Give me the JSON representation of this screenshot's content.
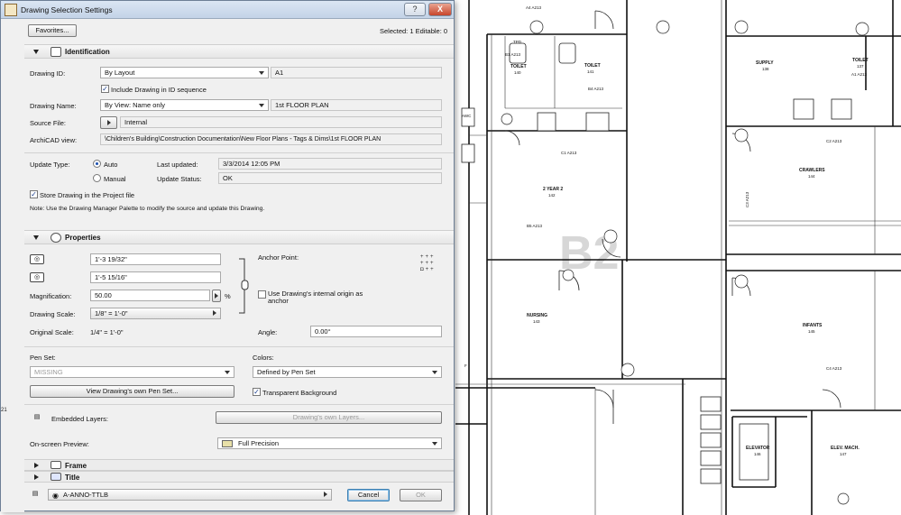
{
  "window": {
    "title": "Drawing Selection Settings",
    "help_label": "?",
    "close_label": "X"
  },
  "header": {
    "favorites_label": "Favorites...",
    "selection_info": "Selected: 1 Editable: 0"
  },
  "identification": {
    "section_title": "Identification",
    "drawing_id_label": "Drawing ID:",
    "drawing_id_mode": "By Layout",
    "drawing_id_value": "A1",
    "include_in_sequence_label": "Include Drawing in ID sequence",
    "include_in_sequence_checked": true,
    "drawing_name_label": "Drawing Name:",
    "drawing_name_mode": "By View: Name only",
    "drawing_name_value": "1st FLOOR PLAN",
    "source_file_label": "Source File:",
    "source_file_value": "Internal",
    "archicad_view_label": "ArchiCAD view:",
    "archicad_view_value": "\\Children's Building\\Construction Documentation\\New Floor Plans - Tags & Dims\\1st FLOOR PLAN",
    "update_type_label": "Update Type:",
    "update_auto_label": "Auto",
    "update_manual_label": "Manual",
    "last_updated_label": "Last updated:",
    "last_updated_value": "3/3/2014 12:05 PM",
    "update_status_label": "Update Status:",
    "update_status_value": "OK",
    "store_drawing_label": "Store Drawing in the Project file",
    "store_drawing_checked": true,
    "note": "Note:   Use the Drawing Manager Palette to modify the source and update this Drawing."
  },
  "properties": {
    "section_title": "Properties",
    "width_value": "1'-3 19/32\"",
    "height_value": "1'-5 15/16\"",
    "magnification_label": "Magnification:",
    "magnification_value": "50.00",
    "magnification_unit": "%",
    "drawing_scale_label": "Drawing Scale:",
    "drawing_scale_value": "1/8\"   =   1'-0\"",
    "original_scale_label": "Original Scale:",
    "original_scale_value": "1/4\"   =   1'-0\"",
    "anchor_point_label": "Anchor Point:",
    "internal_origin_label": "Use Drawing's internal origin as anchor",
    "internal_origin_checked": false,
    "angle_label": "Angle:",
    "angle_value": "0.00°",
    "pen_set_label": "Pen Set:",
    "pen_set_value": "MISSING",
    "view_pen_set_label": "View Drawing's own Pen Set...",
    "colors_label": "Colors:",
    "colors_value": "Defined by Pen Set",
    "transparent_bg_label": "Transparent Background",
    "transparent_bg_checked": true,
    "embedded_layers_label": "Embedded Layers:",
    "own_layers_label": "Drawing's own Layers...",
    "preview_label": "On-screen Preview:",
    "preview_value": "Full Precision"
  },
  "collapsed_sections": {
    "frame_title": "Frame",
    "title_title": "Title"
  },
  "footer": {
    "layer_value": "A-ANNO-TTLB",
    "cancel_label": "Cancel",
    "ok_label": "OK"
  },
  "plan": {
    "watermark": "B2",
    "edge_mark": "21",
    "rooms": [
      {
        "name": "TOILET",
        "number": "140"
      },
      {
        "name": "TOILET",
        "number": "141"
      },
      {
        "name": "2 YEAR 2",
        "number": "142"
      },
      {
        "name": "NURSING",
        "number": "143"
      },
      {
        "name": "SUPPLY",
        "number": "138"
      },
      {
        "name": "TOILET",
        "number": "137"
      },
      {
        "name": "CRAWLERS",
        "number": "144"
      },
      {
        "name": "INFANTS",
        "number": "145"
      },
      {
        "name": "ELEVATOR",
        "number": "146"
      },
      {
        "name": "ELEV. MACH.",
        "number": "147"
      }
    ],
    "tags": [
      "A4 A213",
      "B1 A213",
      "B4 A213",
      "C1 A213",
      "B5 A213",
      "C2 A213",
      "A1 A213",
      "C3 A213",
      "C4 A213",
      "TPD",
      "AWC",
      "F"
    ]
  }
}
